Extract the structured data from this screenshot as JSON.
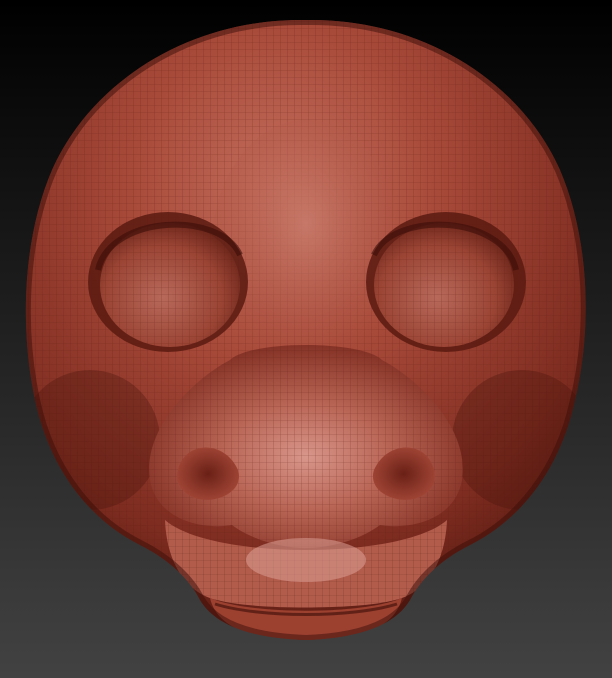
{
  "viewport": {
    "background_top": "#000000",
    "background_bottom": "#424242"
  },
  "model": {
    "kind": "sculpt-head",
    "material_base": "#a84a3a",
    "material_highlight": "#d8968a",
    "material_shadow": "#4a140c",
    "wireframe_visible": true,
    "wireframe_color": "#6e2418"
  }
}
